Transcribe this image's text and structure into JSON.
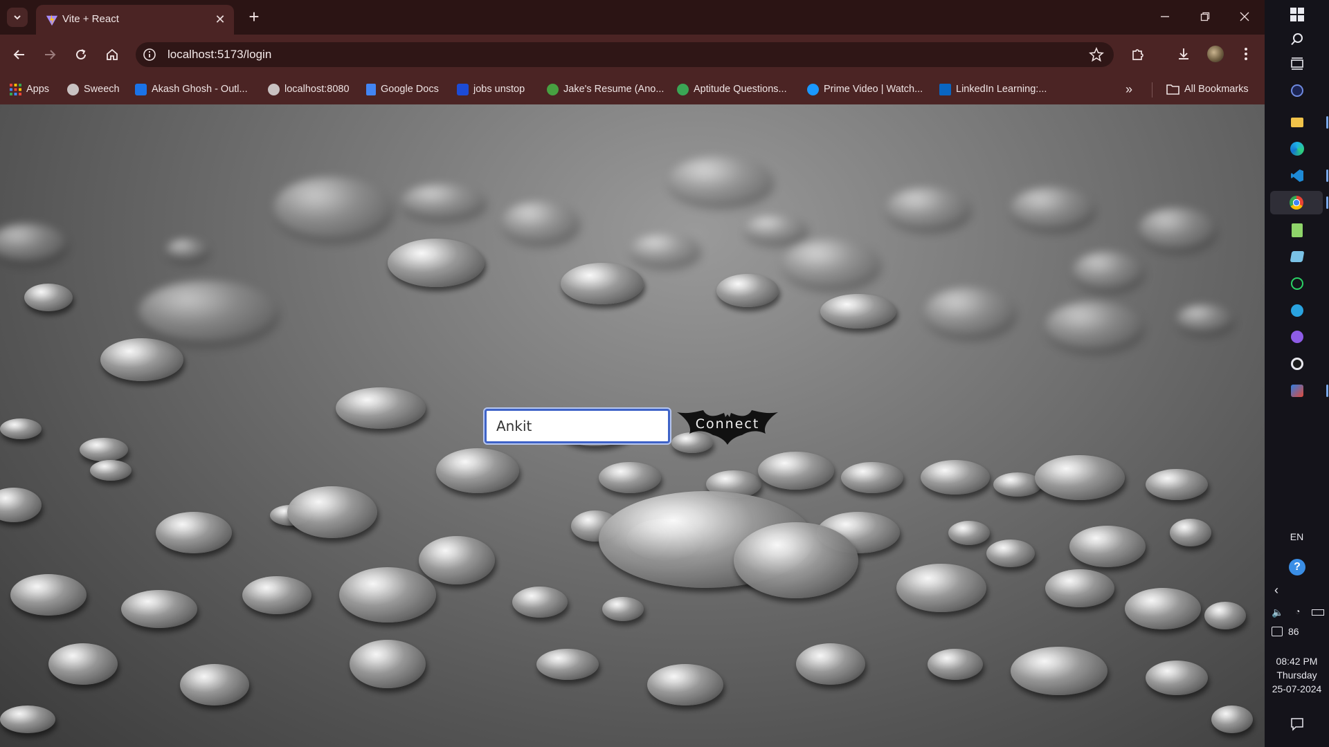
{
  "tab": {
    "title": "Vite + React"
  },
  "address_bar": {
    "url": "localhost:5173/login"
  },
  "bookmarks": [
    {
      "label": "Apps",
      "icon": "apps-grid-icon",
      "color": "#e8453c"
    },
    {
      "label": "Sweech",
      "icon": "globe-icon",
      "color": "#c9c2c2"
    },
    {
      "label": "Akash Ghosh - Outl...",
      "icon": "outlook-icon",
      "color": "#1a73e8"
    },
    {
      "label": "localhost:8080",
      "icon": "globe-icon",
      "color": "#c9c2c2"
    },
    {
      "label": "Google Docs",
      "icon": "docs-icon",
      "color": "#4285f4"
    },
    {
      "label": "jobs unstop",
      "icon": "unstop-icon",
      "color": "#1c4bd6"
    },
    {
      "label": "Jake's Resume (Ano...",
      "icon": "overleaf-icon",
      "color": "#47a141"
    },
    {
      "label": "Aptitude Questions...",
      "icon": "indiabix-icon",
      "color": "#3aa655"
    },
    {
      "label": "Prime Video | Watch...",
      "icon": "prime-video-icon",
      "color": "#1a98ff"
    },
    {
      "label": "LinkedIn Learning:...",
      "icon": "linkedin-learning-icon",
      "color": "#0a66c2"
    }
  ],
  "all_bookmarks_label": "All Bookmarks",
  "login": {
    "name_value": "Ankit",
    "connect_label": "Connect"
  },
  "taskbar": {
    "language": "EN",
    "notification_count": "86",
    "time": "08:42 PM",
    "day": "Thursday",
    "date": "25-07-2024"
  }
}
